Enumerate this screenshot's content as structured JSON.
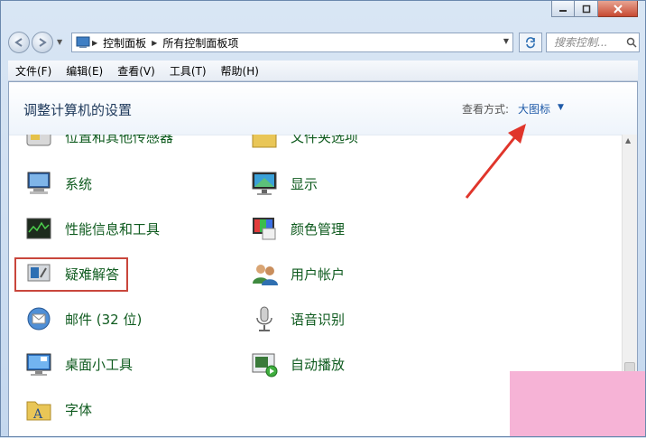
{
  "breadcrumb": [
    "控制面板",
    "所有控制面板项"
  ],
  "search": {
    "placeholder": "搜索控制..."
  },
  "menu": [
    "文件(F)",
    "编辑(E)",
    "查看(V)",
    "工具(T)",
    "帮助(H)"
  ],
  "header": {
    "title": "调整计算机的设置",
    "view_label": "查看方式:",
    "view_value": "大图标"
  },
  "items": [
    {
      "label": "位置和其他传感器",
      "icon": "sensor-icon"
    },
    {
      "label": "文件夹选项",
      "icon": "folder-icon"
    },
    {
      "label": "系统",
      "icon": "computer-icon"
    },
    {
      "label": "显示",
      "icon": "monitor-icon"
    },
    {
      "label": "性能信息和工具",
      "icon": "performance-icon"
    },
    {
      "label": "颜色管理",
      "icon": "color-icon"
    },
    {
      "label": "疑难解答",
      "icon": "troubleshoot-icon"
    },
    {
      "label": "用户帐户",
      "icon": "users-icon"
    },
    {
      "label": "邮件 (32 位)",
      "icon": "mail-icon"
    },
    {
      "label": "语音识别",
      "icon": "microphone-icon"
    },
    {
      "label": "桌面小工具",
      "icon": "gadgets-icon"
    },
    {
      "label": "自动播放",
      "icon": "autoplay-icon"
    },
    {
      "label": "字体",
      "icon": "font-icon"
    }
  ],
  "colors": {
    "highlight": "#c9463c",
    "link": "#0f5b1f",
    "arrow": "#e0352b"
  }
}
